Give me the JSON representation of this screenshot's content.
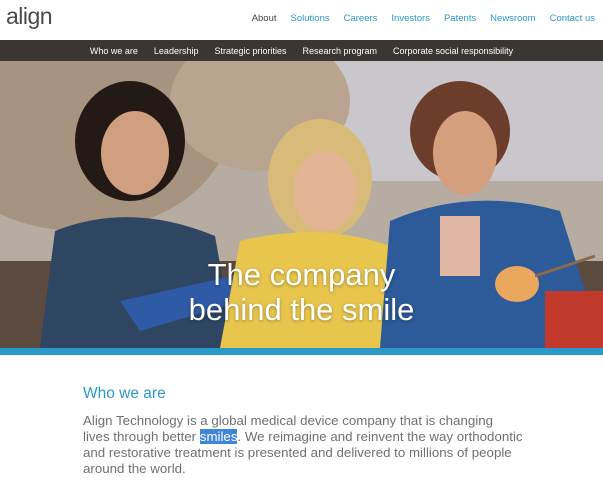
{
  "brand": {
    "logo_text": "align"
  },
  "main_nav": [
    {
      "label": "About"
    },
    {
      "label": "Solutions"
    },
    {
      "label": "Careers"
    },
    {
      "label": "Investors"
    },
    {
      "label": "Patents"
    },
    {
      "label": "Newsroom"
    },
    {
      "label": "Contact us"
    }
  ],
  "sub_nav": [
    {
      "label": "Who we are"
    },
    {
      "label": "Leadership"
    },
    {
      "label": "Strategic priorities"
    },
    {
      "label": "Research program"
    },
    {
      "label": "Corporate social responsibility"
    }
  ],
  "hero": {
    "title_line1": "The company",
    "title_line2": "behind the smile"
  },
  "section": {
    "heading": "Who we are",
    "body_before": "Align Technology is a global medical device company that is changing lives through better ",
    "body_highlight": "smiles",
    "body_after": ". We reimagine and reinvent the way orthodontic and restorative treatment is presented and delivered to millions of people around the world."
  },
  "colors": {
    "accent": "#2a98c9",
    "subnav_bg": "#3a3633",
    "highlight": "#3f86d9"
  }
}
